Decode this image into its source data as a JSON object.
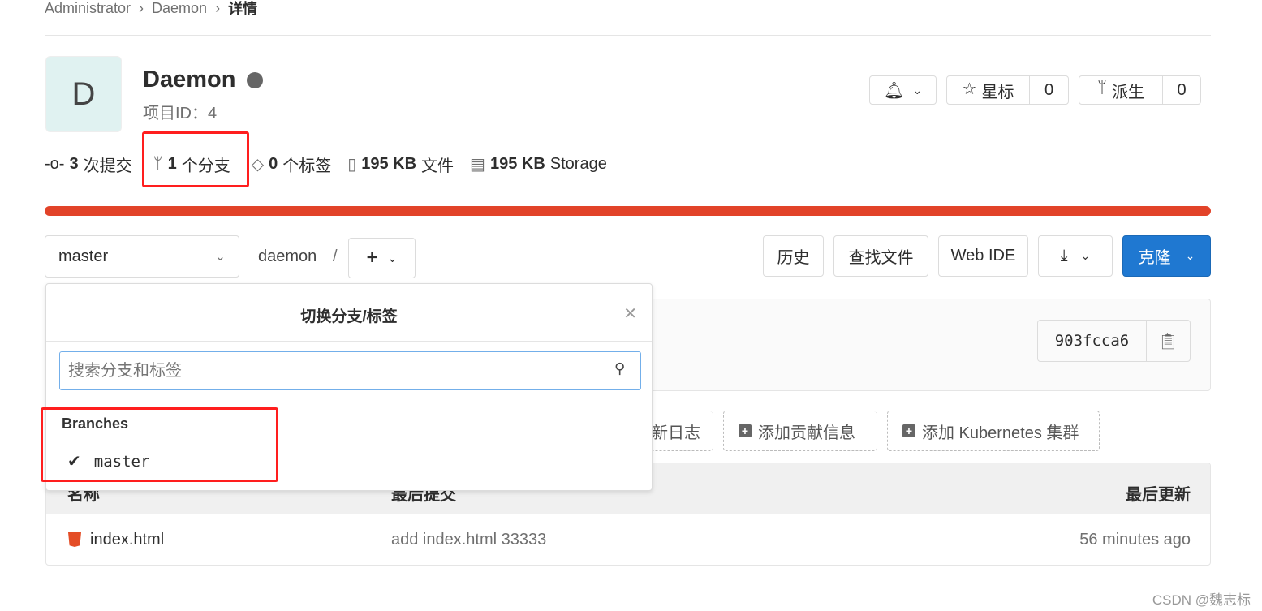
{
  "breadcrumb": [
    "Administrator",
    "Daemon",
    "详情"
  ],
  "project": {
    "avatar_letter": "D",
    "name": "Daemon",
    "id_label": "项目ID：4",
    "visibility_icon": "globe-icon"
  },
  "stats": [
    {
      "icon": "commit-icon",
      "value": "3",
      "label": "次提交"
    },
    {
      "icon": "branch-icon",
      "value": "1",
      "label": "个分支"
    },
    {
      "icon": "tag-icon",
      "value": "0",
      "label": "个标签"
    },
    {
      "icon": "file-icon",
      "value": "195 KB",
      "label": "文件"
    },
    {
      "icon": "storage-icon",
      "value": "195 KB",
      "label": "Storage"
    }
  ],
  "actions": {
    "star_label": "星标",
    "star_count": "0",
    "fork_label": "派生",
    "fork_count": "0"
  },
  "progress": {
    "color": "#e24329",
    "percent": 100
  },
  "toolbar": {
    "branch": "master",
    "path": "daemon",
    "sep": "/",
    "plus": "+",
    "history": "历史",
    "find_file": "查找文件",
    "web_ide": "Web IDE",
    "clone": "克隆"
  },
  "dropdown": {
    "title": "切换分支/标签",
    "search_placeholder": "搜索分支和标签",
    "section": "Branches",
    "items": [
      {
        "name": "master",
        "selected": true
      }
    ]
  },
  "commit": {
    "sha": "903fcca6"
  },
  "quick_actions": [
    "新日志",
    "添加贡献信息",
    "添加 Kubernetes 集群"
  ],
  "table": {
    "headers": [
      "名称",
      "最后提交",
      "最后更新"
    ],
    "rows": [
      {
        "name": "index.html",
        "commit": "add index.html 33333",
        "updated": "56 minutes ago"
      }
    ]
  },
  "watermark": "CSDN @魏志标",
  "colors": {
    "accent": "#1f78d1",
    "highlight": "#ff1e1e"
  }
}
